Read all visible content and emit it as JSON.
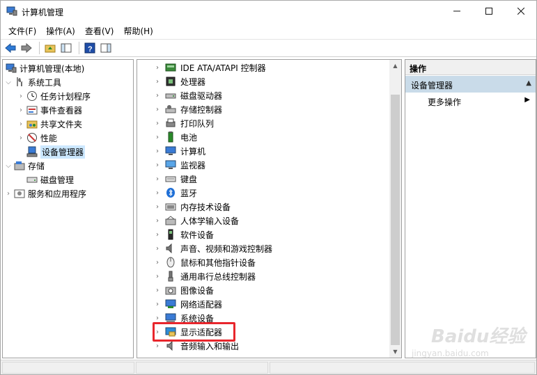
{
  "window": {
    "title": "计算机管理"
  },
  "menubar": {
    "items": [
      "文件(F)",
      "操作(A)",
      "查看(V)",
      "帮助(H)"
    ]
  },
  "tree": {
    "root": "计算机管理(本地)",
    "system_tools": "系统工具",
    "task_scheduler": "任务计划程序",
    "event_viewer": "事件查看器",
    "shared_folders": "共享文件夹",
    "performance": "性能",
    "device_manager": "设备管理器",
    "storage": "存储",
    "disk_management": "磁盘管理",
    "services_apps": "服务和应用程序"
  },
  "devices": [
    "IDE ATA/ATAPI 控制器",
    "处理器",
    "磁盘驱动器",
    "存储控制器",
    "打印队列",
    "电池",
    "计算机",
    "监视器",
    "键盘",
    "蓝牙",
    "内存技术设备",
    "人体学输入设备",
    "软件设备",
    "声音、视频和游戏控制器",
    "鼠标和其他指针设备",
    "通用串行总线控制器",
    "图像设备",
    "网络适配器",
    "系统设备",
    "显示适配器",
    "音频输入和输出"
  ],
  "actions": {
    "header": "操作",
    "section": "设备管理器",
    "more": "更多操作"
  },
  "watermark": {
    "text": "Baidu经验",
    "sub": "jingyan.baidu.com"
  },
  "colors": {
    "highlight": "#e8262c",
    "selection": "#cce8ff",
    "action_section": "#c9dbe9"
  }
}
